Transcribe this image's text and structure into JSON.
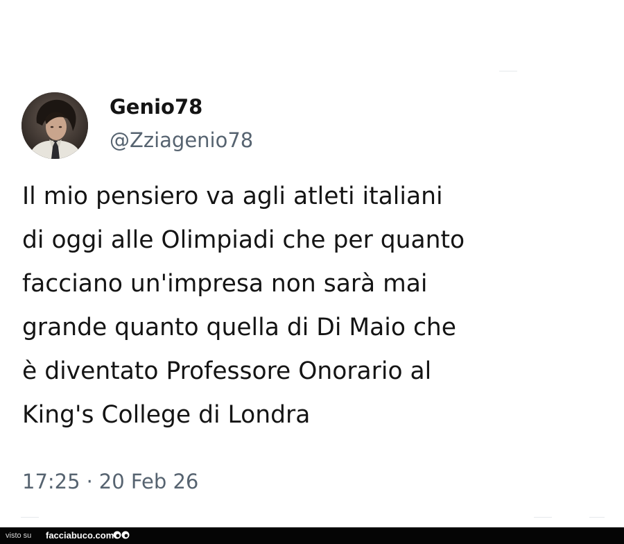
{
  "tweet": {
    "display_name": "Genio78",
    "handle": "@Zziagenio78",
    "text_lines": [
      "Il mio pensiero va agli atleti italiani",
      "di oggi alle Olimpiadi che per quanto",
      "facciano un'impresa non sarà mai",
      "grande quanto quella di Di Maio che",
      "è diventato Professore Onorario al",
      "King's College di Londra"
    ],
    "time": "17:25",
    "separator": "·",
    "date": "20 Feb 26",
    "avatar_icon": "profile-photo"
  },
  "footer": {
    "label": "visto su",
    "brand": "facciabuco.com",
    "logo_icon": "eyes-icon"
  },
  "colors": {
    "text": "#141414",
    "secondary_text": "#566370",
    "background": "#ffffff",
    "footer_bg": "#050505"
  }
}
